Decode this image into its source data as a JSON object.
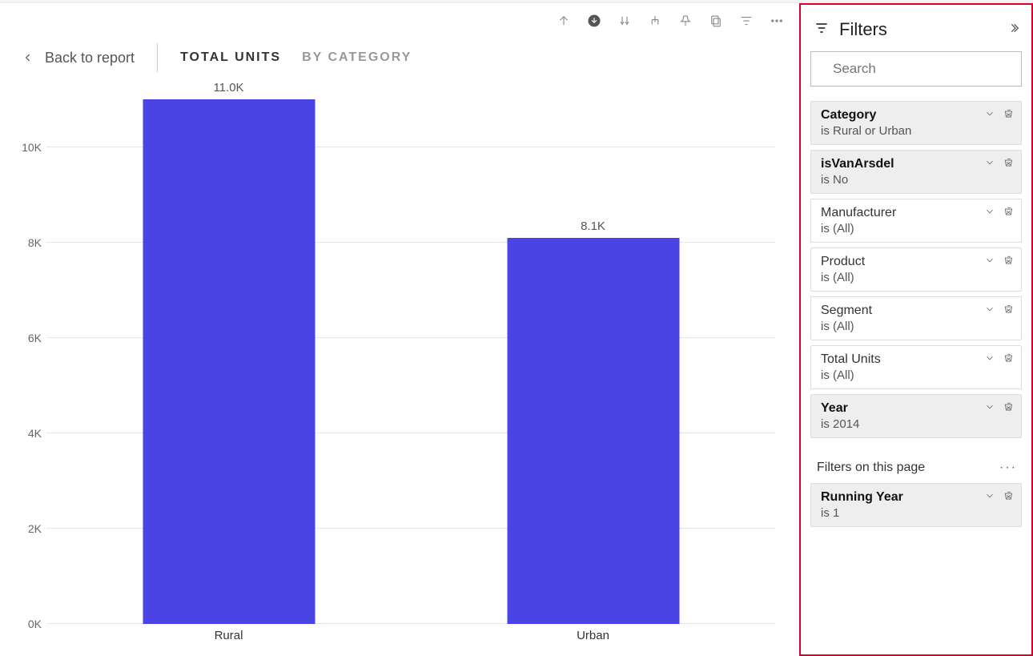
{
  "nav": {
    "back_label": "Back to report",
    "tabs": [
      {
        "label": "TOTAL UNITS",
        "active": true
      },
      {
        "label": "BY CATEGORY",
        "active": false
      }
    ]
  },
  "chart_data": {
    "type": "bar",
    "categories": [
      "Rural",
      "Urban"
    ],
    "values": [
      11000,
      8100
    ],
    "display_labels": [
      "11.0K",
      "8.1K"
    ],
    "ylim": [
      0,
      11000
    ],
    "yticks": [
      0,
      2000,
      4000,
      6000,
      8000,
      10000
    ],
    "ytick_labels": [
      "0K",
      "2K",
      "4K",
      "6K",
      "8K",
      "10K"
    ],
    "bar_color": "#4b44e4",
    "title": "",
    "xlabel": "",
    "ylabel": ""
  },
  "filters_pane": {
    "title": "Filters",
    "search_placeholder": "Search",
    "cards": [
      {
        "name": "Category",
        "value": "is Rural or Urban",
        "applied": true
      },
      {
        "name": "isVanArsdel",
        "value": "is No",
        "applied": true
      },
      {
        "name": "Manufacturer",
        "value": "is (All)",
        "applied": false
      },
      {
        "name": "Product",
        "value": "is (All)",
        "applied": false
      },
      {
        "name": "Segment",
        "value": "is (All)",
        "applied": false
      },
      {
        "name": "Total Units",
        "value": "is (All)",
        "applied": false
      },
      {
        "name": "Year",
        "value": "is 2014",
        "applied": true
      }
    ],
    "page_section_label": "Filters on this page",
    "page_cards": [
      {
        "name": "Running Year",
        "value": "is 1",
        "applied": true
      }
    ]
  }
}
